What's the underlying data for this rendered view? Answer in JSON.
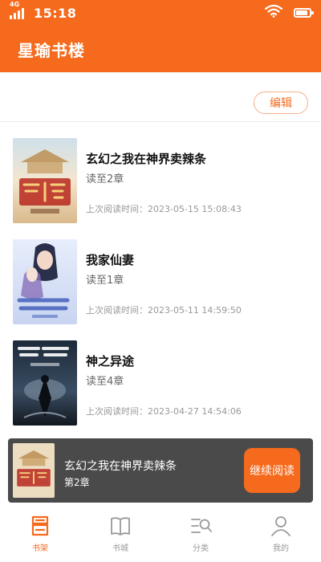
{
  "status_bar": {
    "network": "4G",
    "time": "15:18",
    "battery_level": 0.9
  },
  "header": {
    "title": "星瑜书楼"
  },
  "toolbar": {
    "edit_label": "编辑"
  },
  "books": [
    {
      "title": "玄幻之我在神界卖辣条",
      "progress": "读至2章",
      "last_read": "上次阅读时间：2023-05-15 15:08:43",
      "cover_icon": "cover-golden-palace"
    },
    {
      "title": "我家仙妻",
      "progress": "读至1章",
      "last_read": "上次阅读时间：2023-05-11 14:59:50",
      "cover_icon": "cover-couple"
    },
    {
      "title": "神之异途",
      "progress": "读至4章",
      "last_read": "上次阅读时间：2023-04-27 14:54:06",
      "cover_icon": "cover-dark-hero"
    }
  ],
  "continue_reading": {
    "title": "玄幻之我在神界卖辣条",
    "chapter": "第2章",
    "button_label": "继续阅读"
  },
  "tabs": [
    {
      "label": "书架",
      "icon": "bookshelf-icon",
      "active": true
    },
    {
      "label": "书城",
      "icon": "book-open-icon",
      "active": false
    },
    {
      "label": "分类",
      "icon": "category-search-icon",
      "active": false
    },
    {
      "label": "我的",
      "icon": "user-icon",
      "active": false
    }
  ],
  "colors": {
    "accent": "#f56a1c",
    "continue_bar_bg": "#4b4a4a"
  }
}
